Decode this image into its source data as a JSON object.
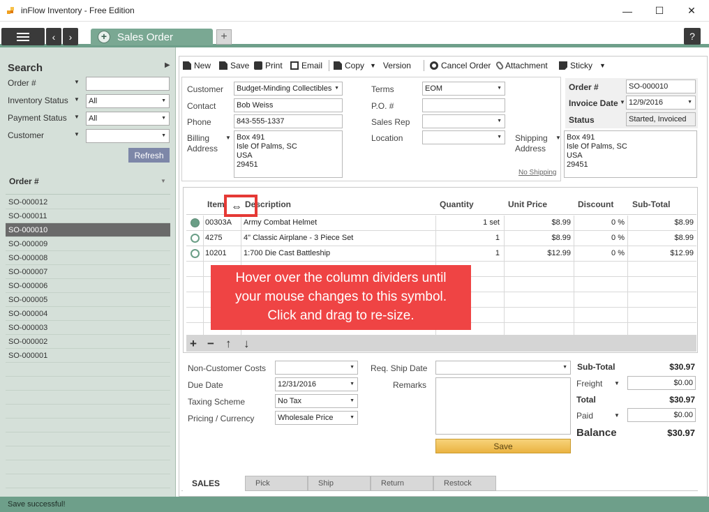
{
  "window": {
    "title": "inFlow Inventory - Free Edition"
  },
  "tabs": {
    "active_label": "Sales Order",
    "add_label": "+",
    "help_label": "?"
  },
  "search": {
    "title": "Search",
    "filters": [
      {
        "label": "Order #",
        "value": ""
      },
      {
        "label": "Inventory Status",
        "value": "All"
      },
      {
        "label": "Payment Status",
        "value": "All"
      },
      {
        "label": "Customer",
        "value": ""
      }
    ],
    "refresh_label": "Refresh"
  },
  "orders": {
    "header": "Order #",
    "items": [
      "SO-000012",
      "SO-000011",
      "SO-000010",
      "SO-000009",
      "SO-000008",
      "SO-000007",
      "SO-000006",
      "SO-000005",
      "SO-000004",
      "SO-000003",
      "SO-000002",
      "SO-000001"
    ],
    "selected": "SO-000010"
  },
  "toolbar": {
    "new": "New",
    "save": "Save",
    "print": "Print",
    "email": "Email",
    "copy": "Copy",
    "version": "Version",
    "cancel": "Cancel Order",
    "attachment": "Attachment",
    "sticky": "Sticky"
  },
  "header": {
    "customer_label": "Customer",
    "customer": "Budget-Minding Collectibles",
    "contact_label": "Contact",
    "contact": "Bob Weiss",
    "phone_label": "Phone",
    "phone": "843-555-1337",
    "billing_label1": "Billing",
    "billing_label2": "Address",
    "billing_lines": [
      "Box 491",
      "Isle Of Palms, SC",
      "USA",
      "29451"
    ],
    "terms_label": "Terms",
    "terms": "EOM",
    "po_label": "P.O. #",
    "po": "",
    "salesrep_label": "Sales Rep",
    "salesrep": "",
    "location_label": "Location",
    "location": "",
    "shipping_label1": "Shipping",
    "shipping_label2": "Address",
    "shipping_lines": [
      "Box 491",
      "Isle Of Palms, SC",
      "USA",
      "29451"
    ],
    "no_shipping": "No Shipping",
    "order_no_label": "Order #",
    "order_no": "SO-000010",
    "invoice_date_label": "Invoice Date",
    "invoice_date": "12/9/2016",
    "status_label": "Status",
    "status": "Started, Invoiced"
  },
  "grid": {
    "columns": [
      "Item",
      "Description",
      "Quantity",
      "Unit Price",
      "Discount",
      "Sub-Total"
    ],
    "rows": [
      {
        "item": "00303A",
        "description": "Army Combat Helmet",
        "quantity": "1 set",
        "unit_price": "$8.99",
        "discount": "0 %",
        "subtotal": "$8.99"
      },
      {
        "item": "4275",
        "description": "4\" Classic Airplane - 3 Piece Set",
        "quantity": "1",
        "unit_price": "$8.99",
        "discount": "0 %",
        "subtotal": "$8.99"
      },
      {
        "item": "10201",
        "description": "1:700 Die Cast Battleship",
        "quantity": "1",
        "unit_price": "$12.99",
        "discount": "0 %",
        "subtotal": "$12.99"
      }
    ],
    "footer_buttons": [
      "+",
      "−",
      "↑",
      "↓"
    ]
  },
  "tip": {
    "lines": [
      "Hover over the column dividers until",
      "your mouse changes to this symbol.",
      "Click and drag to re-size."
    ]
  },
  "lower": {
    "noncust_label": "Non-Customer Costs",
    "noncust": "",
    "due_label": "Due Date",
    "due": "12/31/2016",
    "tax_label": "Taxing Scheme",
    "tax": "No Tax",
    "pricing_label": "Pricing / Currency",
    "pricing": "Wholesale Price",
    "reqship_label": "Req. Ship Date",
    "reqship": "",
    "remarks_label": "Remarks",
    "save_label": "Save"
  },
  "totals": {
    "subtotal_label": "Sub-Total",
    "subtotal": "$30.97",
    "freight_label": "Freight",
    "freight": "$0.00",
    "total_label": "Total",
    "total": "$30.97",
    "paid_label": "Paid",
    "paid": "$0.00",
    "balance_label": "Balance",
    "balance": "$30.97"
  },
  "bottom_tabs": [
    "SALES",
    "Pick",
    "Ship",
    "Return",
    "Restock"
  ],
  "status_bar": "Save successful!"
}
